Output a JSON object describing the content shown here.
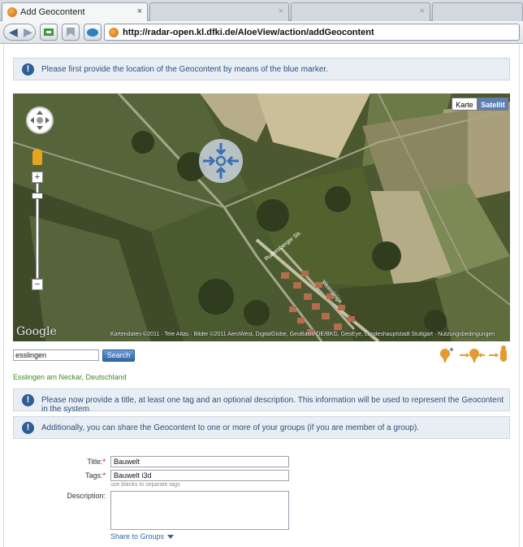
{
  "browser": {
    "tabs": [
      {
        "title": "Add Geocontent",
        "close": "×"
      },
      {
        "title": "",
        "close": "×"
      },
      {
        "title": "",
        "close": "×"
      },
      {
        "title": "",
        "close": ""
      }
    ],
    "url": "http://radar-open.kl.dfki.de/AloeView/action/addGeocontent"
  },
  "notices": {
    "marker": "Please first provide the location of the Geocontent by means of the blue marker.",
    "details": "Please now provide a title, at least one tag and an optional description. This information will be used to represent the Geocontent in the system",
    "groups": "Additionally, you can share the Geocontent to one or more of your groups (if you are member of a group).",
    "icon": "!"
  },
  "map": {
    "type_buttons": {
      "karte": "Karte",
      "satellit": "Satellit"
    },
    "logo": "Google",
    "attribution": "Kartendaten ©2011 · Tele Atlas · Bilder ©2011 AeroWest, DigitalGlobe, GeoBasis-DE/BKG, GeoEye, Landeshauptstadt Stuttgart · Nutzungsbedingungen",
    "street_labels": [
      "Rudersberger Str.",
      "Weinsteige"
    ]
  },
  "search": {
    "value": "esslingen",
    "button": "Search",
    "result": "Esslingen am Neckar, Deutschland"
  },
  "form": {
    "title_label": "Title:",
    "title_value": "Bauwelt",
    "tags_label": "Tags:",
    "tags_value": "Bauwelt i3d",
    "tags_hint": "use blanks to separate tags",
    "required_mark": "*",
    "description_label": "Description:",
    "description_value": "",
    "share_label": "Share to Groups"
  },
  "colors": {
    "accent": "#2f64ab",
    "notice_bg": "#e9eef4",
    "result_green": "#3d8b1f"
  }
}
